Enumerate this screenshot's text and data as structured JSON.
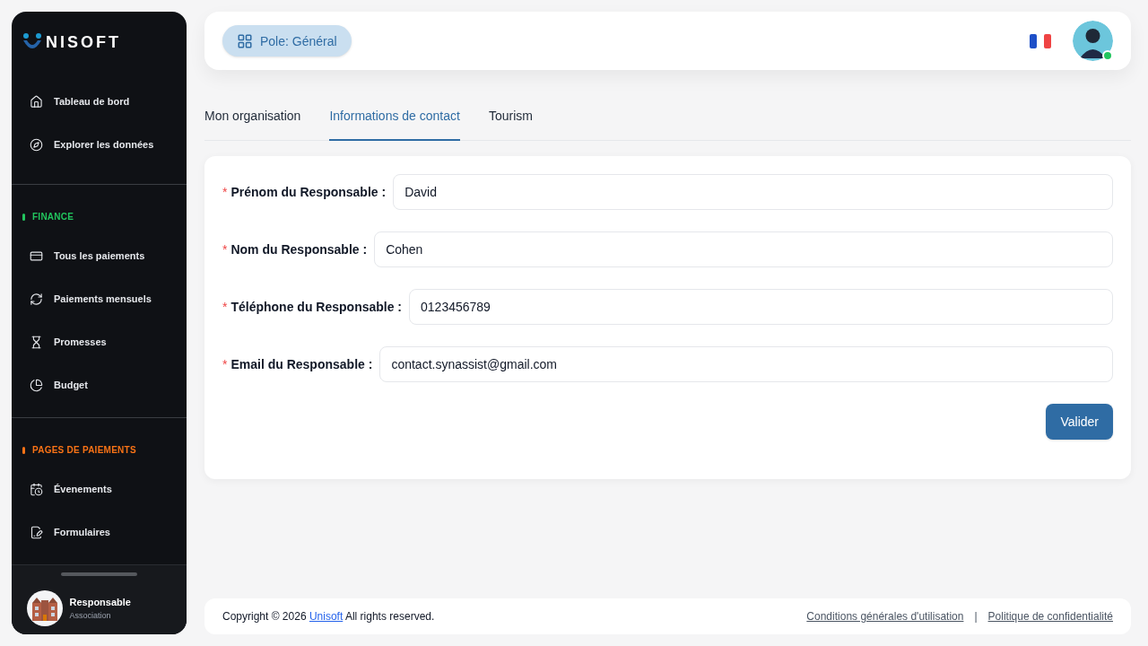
{
  "sidebar": {
    "logo_text": "NISOFT",
    "groups": [
      {
        "items": [
          {
            "label": "Tableau de bord"
          },
          {
            "label": "Explorer les données"
          }
        ]
      },
      {
        "title": "FINANCE",
        "color": "#22c55e",
        "items": [
          {
            "label": "Tous les paiements"
          },
          {
            "label": "Paiements mensuels"
          },
          {
            "label": "Promesses"
          },
          {
            "label": "Budget"
          }
        ]
      },
      {
        "title": "PAGES DE PAIEMENTS",
        "color": "#f97316",
        "items": [
          {
            "label": "Évenements"
          },
          {
            "label": "Formulaires"
          }
        ]
      }
    ],
    "user": {
      "name": "Responsable",
      "role": "Association"
    }
  },
  "header": {
    "pole": "Pole: Général",
    "online": true
  },
  "tabs": [
    {
      "label": "Mon organisation",
      "selected": false
    },
    {
      "label": "Informations de contact",
      "selected": true
    },
    {
      "label": "Tourism",
      "selected": false
    }
  ],
  "form": {
    "fields": [
      {
        "required_mark": "*",
        "label": "Prénom du Responsable :",
        "value": "David"
      },
      {
        "required_mark": "*",
        "label": "Nom du Responsable :",
        "value": "Cohen"
      },
      {
        "required_mark": "*",
        "label": "Téléphone du Responsable :",
        "value": "0123456789"
      },
      {
        "required_mark": "*",
        "label": "Email du Responsable :",
        "value": "contact.synassist@gmail.com"
      }
    ],
    "submit": "Valider"
  },
  "footer": {
    "copyright_before": "Copyright © 2026 ",
    "copyright_link": "Unisoft",
    "copyright_after": " All rights reserved.",
    "links": [
      "Conditions générales d'utilisation",
      "Politique de confidentialité"
    ],
    "separator": "|"
  }
}
